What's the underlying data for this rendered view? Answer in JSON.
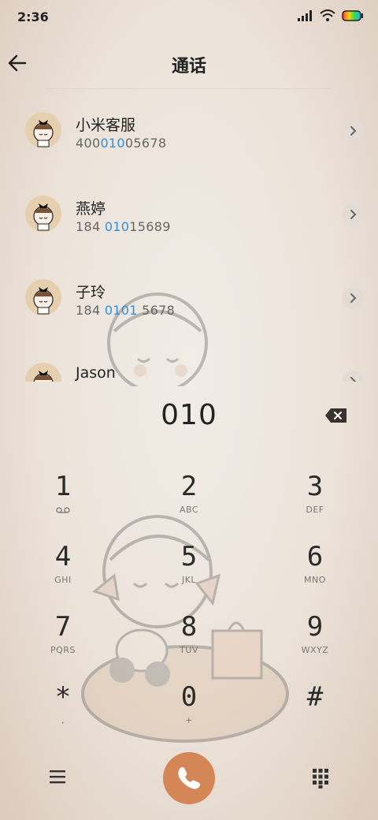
{
  "status_bar": {
    "time": "2:36"
  },
  "header": {
    "title": "通话",
    "back_icon": "arrow-left-icon"
  },
  "contacts": [
    {
      "name": "小米客服",
      "number_pre": "400",
      "number_hl": "010",
      "number_post": "05678"
    },
    {
      "name": "燕婷",
      "number_pre": "184 ",
      "number_hl": "010",
      "number_post": "15689"
    },
    {
      "name": "子玲",
      "number_pre": "184 ",
      "number_hl": "0101",
      "number_post": " 5678"
    },
    {
      "name": "Jason",
      "number_pre": "",
      "number_hl": "",
      "number_post": ""
    }
  ],
  "dialer": {
    "input": "010",
    "keys": [
      {
        "digit": "1",
        "letters": ""
      },
      {
        "digit": "2",
        "letters": "ABC"
      },
      {
        "digit": "3",
        "letters": "DEF"
      },
      {
        "digit": "4",
        "letters": "GHI"
      },
      {
        "digit": "5",
        "letters": "JKL"
      },
      {
        "digit": "6",
        "letters": "MNO"
      },
      {
        "digit": "7",
        "letters": "PQRS"
      },
      {
        "digit": "8",
        "letters": "TUV"
      },
      {
        "digit": "9",
        "letters": "WXYZ"
      },
      {
        "digit": "*",
        "letters": ","
      },
      {
        "digit": "0",
        "letters": "+"
      },
      {
        "digit": "#",
        "letters": ""
      }
    ]
  },
  "colors": {
    "accent": "#d48656",
    "highlight": "#2e8fe0"
  }
}
